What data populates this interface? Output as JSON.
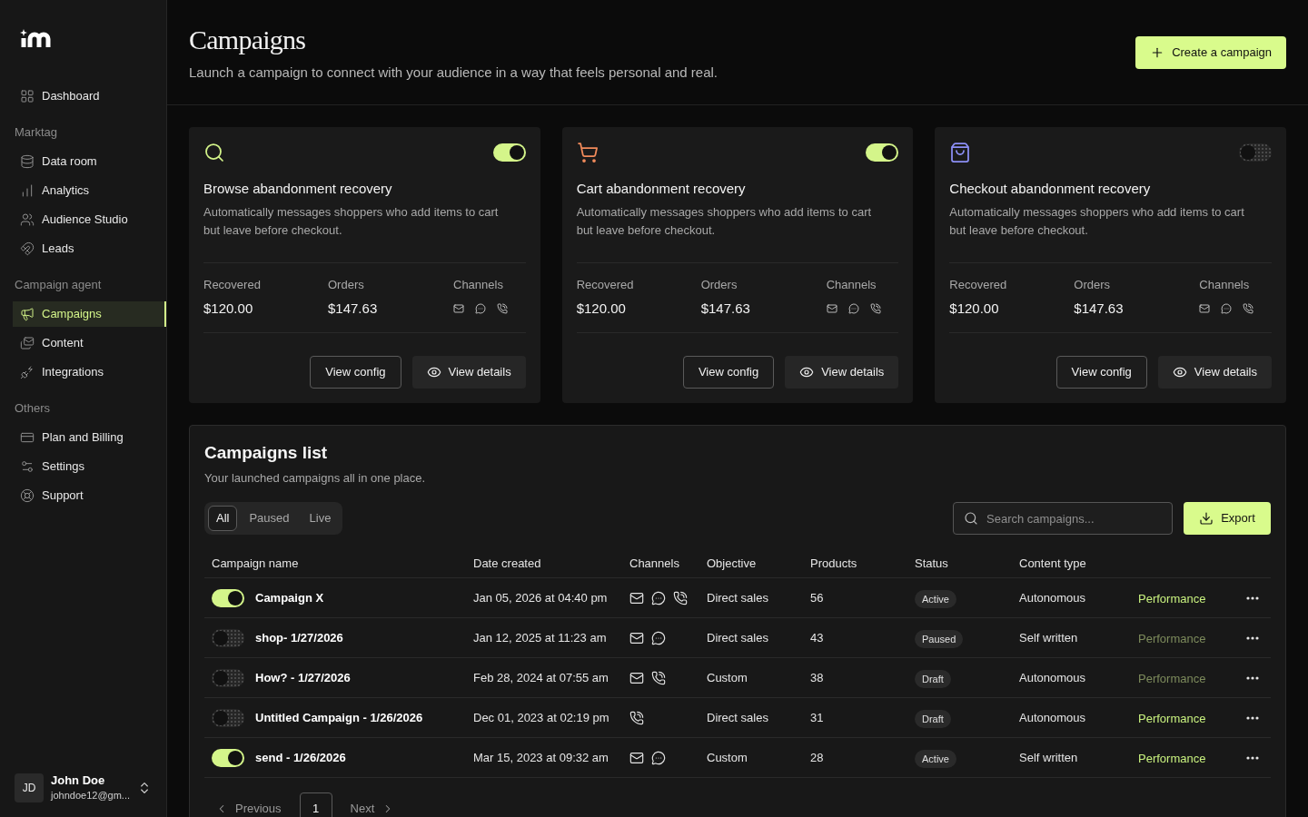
{
  "sidebar": {
    "top_items": [
      {
        "label": "Dashboard",
        "selected": false
      }
    ],
    "sections": [
      {
        "title": "Marktag",
        "items": [
          {
            "label": "Data room",
            "selected": false
          },
          {
            "label": "Analytics",
            "selected": false
          },
          {
            "label": "Audience Studio",
            "selected": false
          },
          {
            "label": "Leads",
            "selected": false
          }
        ]
      },
      {
        "title": "Campaign agent",
        "items": [
          {
            "label": "Campaigns",
            "selected": true
          },
          {
            "label": "Content",
            "selected": false
          },
          {
            "label": "Integrations",
            "selected": false
          }
        ]
      },
      {
        "title": "Others",
        "items": [
          {
            "label": "Plan and Billing",
            "selected": false
          },
          {
            "label": "Settings",
            "selected": false
          },
          {
            "label": "Support",
            "selected": false
          }
        ]
      }
    ],
    "user": {
      "initials": "JD",
      "name": "John Doe",
      "email": "johndoe12@gm..."
    }
  },
  "header": {
    "title": "Campaigns",
    "subtitle": "Launch a campaign to connect with your audience in a way that feels personal and real.",
    "create_button": "Create a campaign"
  },
  "cards": [
    {
      "kind": "browse",
      "color": "#d4f58a",
      "on": true,
      "title": "Browse abandonment recovery",
      "description": "Automatically messages shoppers who add items to cart but leave before checkout.",
      "stats": [
        {
          "label": "Recovered",
          "value": "$120.00"
        },
        {
          "label": "Orders",
          "value": "$147.63"
        }
      ],
      "channels_label": "Channels",
      "channels": [
        {
          "kind": "email"
        },
        {
          "kind": "chat"
        },
        {
          "kind": "phone"
        }
      ],
      "buttons": [
        "View config",
        "View details"
      ]
    },
    {
      "kind": "cart",
      "color": "#f28b5b",
      "on": true,
      "title": "Cart abandonment recovery",
      "description": "Automatically messages shoppers who add items to cart but leave before checkout.",
      "stats": [
        {
          "label": "Recovered",
          "value": "$120.00"
        },
        {
          "label": "Orders",
          "value": "$147.63"
        }
      ],
      "channels_label": "Channels",
      "channels": [
        {
          "kind": "email"
        },
        {
          "kind": "chat"
        },
        {
          "kind": "phone"
        }
      ],
      "buttons": [
        "View config",
        "View details"
      ]
    },
    {
      "kind": "checkout",
      "color": "#8c8ff5",
      "on": false,
      "title": "Checkout abandonment recovery",
      "description": "Automatically messages shoppers who add items to cart but leave before checkout.",
      "stats": [
        {
          "label": "Recovered",
          "value": "$120.00"
        },
        {
          "label": "Orders",
          "value": "$147.63"
        }
      ],
      "channels_label": "Channels",
      "channels": [
        {
          "kind": "email"
        },
        {
          "kind": "chat"
        },
        {
          "kind": "phone"
        }
      ],
      "buttons": [
        "View config",
        "View details"
      ]
    }
  ],
  "campaigns_list": {
    "title": "Campaigns list",
    "subtitle": "Your launched campaigns all in one place.",
    "filters": [
      {
        "label": "All",
        "selected": true
      },
      {
        "label": "Paused",
        "selected": false
      },
      {
        "label": "Live",
        "selected": false
      }
    ],
    "search": {
      "placeholder": "Search campaigns..."
    },
    "export_button": "Export",
    "columns": [
      "Campaign name",
      "Date created",
      "Channels",
      "Objective",
      "Products",
      "Status",
      "Content type"
    ],
    "rows": [
      {
        "on": true,
        "name": "Campaign X",
        "date": "Jan 05, 2026 at 04:40 pm",
        "channels": [
          {
            "kind": "email"
          },
          {
            "kind": "chat"
          },
          {
            "kind": "phone"
          }
        ],
        "objective": "Direct sales",
        "products": "56",
        "status": "Active",
        "content_type": "Autonomous",
        "performance": {
          "label": "Performance",
          "disabled": false
        }
      },
      {
        "on": false,
        "name": "shop- 1/27/2026",
        "date": "Jan 12, 2025 at 11:23 am",
        "channels": [
          {
            "kind": "email"
          },
          {
            "kind": "chat"
          }
        ],
        "objective": "Direct sales",
        "products": "43",
        "status": "Paused",
        "content_type": "Self written",
        "performance": {
          "label": "Performance",
          "disabled": true
        }
      },
      {
        "on": false,
        "name": "How? - 1/27/2026",
        "date": "Feb 28, 2024 at 07:55 am",
        "channels": [
          {
            "kind": "email"
          },
          {
            "kind": "phone"
          }
        ],
        "objective": "Custom",
        "products": "38",
        "status": "Draft",
        "content_type": "Autonomous",
        "performance": {
          "label": "Performance",
          "disabled": true
        }
      },
      {
        "on": false,
        "name": "Untitled Campaign - 1/26/2026",
        "date": "Dec 01, 2023 at 02:19 pm",
        "channels": [
          {
            "kind": "phone"
          }
        ],
        "objective": "Direct sales",
        "products": "31",
        "status": "Draft",
        "content_type": "Autonomous",
        "performance": {
          "label": "Performance",
          "disabled": false
        }
      },
      {
        "on": true,
        "name": "send - 1/26/2026",
        "date": "Mar 15, 2023 at 09:32 am",
        "channels": [
          {
            "kind": "email"
          },
          {
            "kind": "chat"
          }
        ],
        "objective": "Custom",
        "products": "28",
        "status": "Active",
        "content_type": "Self written",
        "performance": {
          "label": "Performance",
          "disabled": false
        }
      }
    ],
    "pagination": {
      "previous": "Previous",
      "pages": [
        {
          "label": "1",
          "selected": true
        }
      ],
      "next": "Next"
    }
  }
}
